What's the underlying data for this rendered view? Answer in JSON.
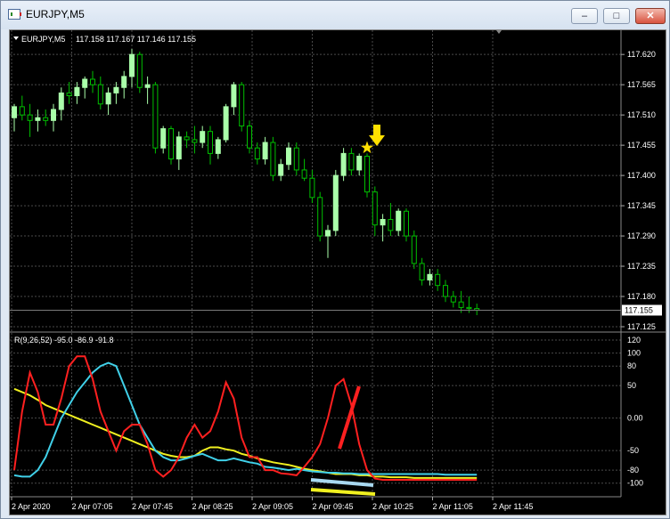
{
  "window": {
    "title": "EURJPY,M5",
    "min_glyph": "–",
    "max_glyph": "□",
    "close_glyph": "✕"
  },
  "main": {
    "label": "EURJPY,M5",
    "ohlc": "117.158 117.167 117.146 117.155",
    "price_ticks": [
      "117.620",
      "117.565",
      "117.510",
      "117.455",
      "117.400",
      "117.345",
      "117.290",
      "117.235",
      "117.180",
      "117.125"
    ],
    "current_price": "117.155"
  },
  "indicator": {
    "label": "R(9,26,52) -95.0 -86.9 -91.8",
    "ticks": [
      "120",
      "100",
      "80",
      "50",
      "0.00",
      "-50",
      "-80",
      "-100"
    ]
  },
  "time_axis": {
    "labels": [
      "2 Apr 2020",
      "2 Apr 07:05",
      "2 Apr 07:45",
      "2 Apr 08:25",
      "2 Apr 09:05",
      "2 Apr 09:45",
      "2 Apr 10:25",
      "2 Apr 11:05",
      "2 Apr 11:45"
    ]
  },
  "colors": {
    "bull": "#aaffaa",
    "bear": "#00c000",
    "grid": "#4a4a4a",
    "red": "#ff2020",
    "cyan": "#40d0e8",
    "yellow": "#f0f020",
    "arrow": "#ffe000",
    "text": "#ffffff"
  },
  "chart_data": {
    "type": "candlestick",
    "price": {
      "ylim": [
        117.125,
        117.63
      ],
      "ohlc": [
        [
          117.505,
          117.53,
          117.48,
          117.525
        ],
        [
          117.525,
          117.545,
          117.5,
          117.51
        ],
        [
          117.51,
          117.53,
          117.47,
          117.5
        ],
        [
          117.5,
          117.52,
          117.48,
          117.505
        ],
        [
          117.505,
          117.52,
          117.49,
          117.5
        ],
        [
          117.5,
          117.53,
          117.48,
          117.52
        ],
        [
          117.52,
          117.56,
          117.5,
          117.55
        ],
        [
          117.55,
          117.57,
          117.53,
          117.545
        ],
        [
          117.545,
          117.57,
          117.53,
          117.56
        ],
        [
          117.56,
          117.58,
          117.54,
          117.575
        ],
        [
          117.575,
          117.59,
          117.55,
          117.565
        ],
        [
          117.565,
          117.58,
          117.52,
          117.53
        ],
        [
          117.53,
          117.56,
          117.51,
          117.55
        ],
        [
          117.55,
          117.57,
          117.53,
          117.56
        ],
        [
          117.56,
          117.59,
          117.54,
          117.58
        ],
        [
          117.58,
          117.63,
          117.56,
          117.62
        ],
        [
          117.62,
          117.625,
          117.55,
          117.56
        ],
        [
          117.56,
          117.58,
          117.53,
          117.565
        ],
        [
          117.565,
          117.57,
          117.44,
          117.45
        ],
        [
          117.45,
          117.49,
          117.44,
          117.485
        ],
        [
          117.485,
          117.49,
          117.42,
          117.43
        ],
        [
          117.43,
          117.48,
          117.41,
          117.47
        ],
        [
          117.47,
          117.48,
          117.45,
          117.465
        ],
        [
          117.465,
          117.49,
          117.44,
          117.46
        ],
        [
          117.46,
          117.49,
          117.45,
          117.48
        ],
        [
          117.48,
          117.49,
          117.42,
          117.44
        ],
        [
          117.44,
          117.47,
          117.43,
          117.465
        ],
        [
          117.465,
          117.53,
          117.46,
          117.525
        ],
        [
          117.525,
          117.57,
          117.51,
          117.565
        ],
        [
          117.565,
          117.57,
          117.48,
          117.49
        ],
        [
          117.49,
          117.5,
          117.44,
          117.45
        ],
        [
          117.45,
          117.46,
          117.42,
          117.43
        ],
        [
          117.43,
          117.47,
          117.42,
          117.46
        ],
        [
          117.46,
          117.47,
          117.39,
          117.4
        ],
        [
          117.4,
          117.43,
          117.39,
          117.42
        ],
        [
          117.42,
          117.46,
          117.41,
          117.45
        ],
        [
          117.45,
          117.46,
          117.4,
          117.41
        ],
        [
          117.41,
          117.43,
          117.39,
          117.395
        ],
        [
          117.395,
          117.41,
          117.35,
          117.36
        ],
        [
          117.36,
          117.37,
          117.28,
          117.29
        ],
        [
          117.29,
          117.31,
          117.25,
          117.3
        ],
        [
          117.3,
          117.41,
          117.29,
          117.4
        ],
        [
          117.4,
          117.45,
          117.39,
          117.44
        ],
        [
          117.44,
          117.45,
          117.4,
          117.41
        ],
        [
          117.41,
          117.44,
          117.4,
          117.435
        ],
        [
          117.435,
          117.44,
          117.36,
          117.37
        ],
        [
          117.37,
          117.38,
          117.29,
          117.31
        ],
        [
          117.31,
          117.33,
          117.28,
          117.32
        ],
        [
          117.32,
          117.35,
          117.29,
          117.3
        ],
        [
          117.3,
          117.34,
          117.29,
          117.335
        ],
        [
          117.335,
          117.34,
          117.28,
          117.29
        ],
        [
          117.29,
          117.3,
          117.23,
          117.24
        ],
        [
          117.24,
          117.25,
          117.2,
          117.21
        ],
        [
          117.21,
          117.23,
          117.2,
          117.22
        ],
        [
          117.22,
          117.23,
          117.19,
          117.2
        ],
        [
          117.2,
          117.21,
          117.17,
          117.18
        ],
        [
          117.18,
          117.19,
          117.16,
          117.17
        ],
        [
          117.17,
          117.19,
          117.15,
          117.16
        ],
        [
          117.16,
          117.18,
          117.15,
          117.158
        ],
        [
          117.158,
          117.167,
          117.146,
          117.155
        ]
      ]
    },
    "indicator": {
      "ylim": [
        -110,
        120
      ],
      "red": [
        -80,
        10,
        70,
        40,
        -10,
        -10,
        30,
        80,
        95,
        95,
        60,
        10,
        -20,
        -50,
        -20,
        -10,
        -10,
        -40,
        -80,
        -90,
        -80,
        -60,
        -30,
        -10,
        -30,
        -20,
        10,
        55,
        30,
        -30,
        -60,
        -60,
        -80,
        -80,
        -85,
        -86,
        -88,
        -75,
        -60,
        -40,
        0,
        50,
        60,
        20,
        -40,
        -80,
        -93,
        -95,
        -95,
        -95,
        -95,
        -95,
        -95,
        -95,
        -95,
        -95,
        -95,
        -95,
        -95,
        -95
      ],
      "cyan": [
        -88,
        -90,
        -90,
        -80,
        -60,
        -30,
        0,
        20,
        40,
        55,
        70,
        80,
        85,
        80,
        50,
        20,
        -10,
        -30,
        -50,
        -60,
        -65,
        -65,
        -62,
        -58,
        -55,
        -60,
        -65,
        -65,
        -62,
        -65,
        -68,
        -70,
        -75,
        -76,
        -78,
        -80,
        -78,
        -80,
        -82,
        -83,
        -84,
        -84,
        -85,
        -85,
        -86,
        -86,
        -86,
        -86,
        -86,
        -86,
        -86,
        -86,
        -86,
        -86,
        -86,
        -87,
        -87,
        -87,
        -87,
        -87
      ],
      "yellow": [
        45,
        40,
        35,
        28,
        20,
        15,
        10,
        5,
        0,
        -5,
        -10,
        -15,
        -20,
        -25,
        -30,
        -35,
        -40,
        -45,
        -50,
        -55,
        -58,
        -60,
        -60,
        -58,
        -50,
        -45,
        -45,
        -48,
        -50,
        -55,
        -58,
        -62,
        -65,
        -68,
        -70,
        -72,
        -75,
        -78,
        -80,
        -82,
        -84,
        -86,
        -86,
        -86,
        -88,
        -88,
        -90,
        -90,
        -91,
        -91,
        -91,
        -92,
        -92,
        -92,
        -92,
        -92,
        -92,
        -92,
        -92,
        -92
      ]
    }
  }
}
